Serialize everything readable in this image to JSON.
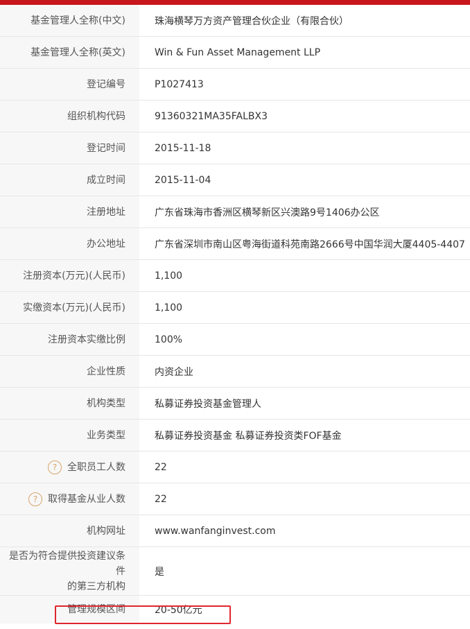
{
  "rows": [
    {
      "label": "基金管理人全称(中文)",
      "value": "珠海横琴万方资产管理合伙企业（有限合伙）"
    },
    {
      "label": "基金管理人全称(英文)",
      "value": "Win & Fun Asset Management LLP"
    },
    {
      "label": "登记编号",
      "value": "P1027413"
    },
    {
      "label": "组织机构代码",
      "value": "91360321MA35FALBX3"
    },
    {
      "label": "登记时间",
      "value": "2015-11-18"
    },
    {
      "label": "成立时间",
      "value": "2015-11-04"
    },
    {
      "label": "注册地址",
      "value": "广东省珠海市香洲区横琴新区兴澳路9号1406办公区"
    },
    {
      "label": "办公地址",
      "value": "广东省深圳市南山区粤海街道科苑南路2666号中国华润大厦4405-4407"
    },
    {
      "label": "注册资本(万元)(人民币)",
      "value": "1,100"
    },
    {
      "label": "实缴资本(万元)(人民币)",
      "value": "1,100"
    },
    {
      "label": "注册资本实缴比例",
      "value": "100%"
    },
    {
      "label": "企业性质",
      "value": "内资企业"
    },
    {
      "label": "机构类型",
      "value": "私募证券投资基金管理人"
    },
    {
      "label": "业务类型",
      "value": "私募证券投资基金  私募证券投资类FOF基金"
    },
    {
      "label": "全职员工人数",
      "value": "22",
      "help": "?"
    },
    {
      "label": "取得基金从业人数",
      "value": "22",
      "help": "?"
    },
    {
      "label": "机构网址",
      "value": "www.wanfanginvest.com"
    },
    {
      "label_lines": [
        "是否为符合提供投资建议条件",
        "的第三方机构"
      ],
      "value": "是"
    },
    {
      "label": "管理规模区间",
      "value": "20-50亿元"
    }
  ],
  "colors": {
    "accent": "#c8161d",
    "highlight_border": "#e0262d",
    "help_icon": "#d9a46b"
  }
}
